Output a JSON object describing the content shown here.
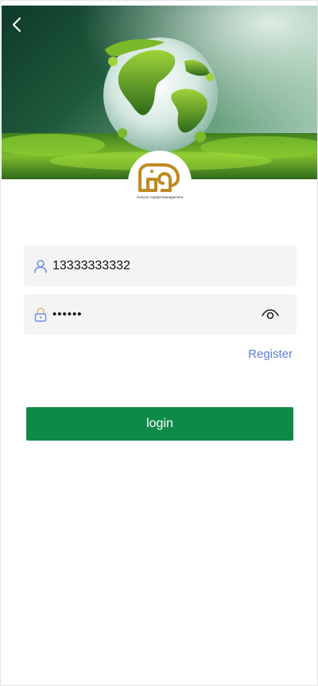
{
  "hero": {
    "back_icon": "chevron-left-icon",
    "image": "green-globe-on-moss"
  },
  "logo": {
    "icon": "elephant-logo",
    "caption": "Horizon Capital Management",
    "color": "#c08a21"
  },
  "form": {
    "phone": {
      "icon": "user-icon",
      "value": "13333333332",
      "placeholder": ""
    },
    "password": {
      "icon": "lock-icon",
      "value": "••••••",
      "toggle_icon": "eye-icon"
    },
    "register_label": "Register",
    "login_label": "login"
  },
  "colors": {
    "accent_green": "#0e8a48",
    "link_blue": "#5b7fdc",
    "field_bg": "#f4f4f4",
    "icon_blue": "#6f8ee6"
  }
}
